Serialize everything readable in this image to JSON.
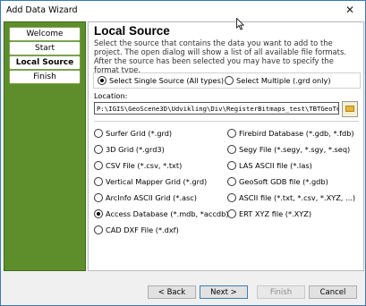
{
  "window": {
    "title": "Add Data Wizard",
    "close_glyph": "✕"
  },
  "nav": {
    "items": [
      {
        "label": "Welcome",
        "active": false
      },
      {
        "label": "Start",
        "active": false
      },
      {
        "label": "Local Source",
        "active": true
      },
      {
        "label": "Finish",
        "active": false
      }
    ]
  },
  "page": {
    "heading": "Local Source",
    "description": "Select the source that contains the data you want to add to the project.  The open dialog will show a list of all available file formats. After the source has been selected you may have to specify the format type.",
    "mode": {
      "single_label": "Select Single Source (All types)",
      "multiple_label": "Select Multiple (.grd only)",
      "selected": "single"
    },
    "location_label": "Location:",
    "location_value": "P:\\IGIS\\GeoScene3D\\Udvikling\\Div\\RegisterBitmaps_test\\TBTGeoTeknik.mc",
    "formats_left": [
      {
        "label": "Surfer Grid (*.grd)",
        "checked": false
      },
      {
        "label": "3D Grid (*.grd3)",
        "checked": false
      },
      {
        "label": "CSV File (*.csv, *.txt)",
        "checked": false
      },
      {
        "label": "Vertical Mapper Grid (*.grd)",
        "checked": false
      },
      {
        "label": "ArcInfo ASCII Grid (*.asc)",
        "checked": false
      },
      {
        "label": "Access Database (*.mdb, *accdb)",
        "checked": true
      },
      {
        "label": "CAD DXF File (*.dxf)",
        "checked": false
      }
    ],
    "formats_right": [
      {
        "label": "Firebird Database (*.gdb, *.fdb)",
        "checked": false
      },
      {
        "label": "Segy File (*.segy, *.sgy, *.seq)",
        "checked": false
      },
      {
        "label": "LAS ASCII file (*.las)",
        "checked": false
      },
      {
        "label": "GeoSoft GDB file (*.gdb)",
        "checked": false
      },
      {
        "label": "ASCII file (*.txt, *.csv, *.XYZ, ...)",
        "checked": false
      },
      {
        "label": "ERT XYZ file (*.XYZ)",
        "checked": false
      }
    ]
  },
  "footer": {
    "back": "< Back",
    "next": "Next >",
    "finish": "Finish",
    "cancel": "Cancel"
  },
  "icons": {
    "browse": "open-folder-icon",
    "close": "close-icon",
    "cursor": "mouse-pointer-icon"
  }
}
